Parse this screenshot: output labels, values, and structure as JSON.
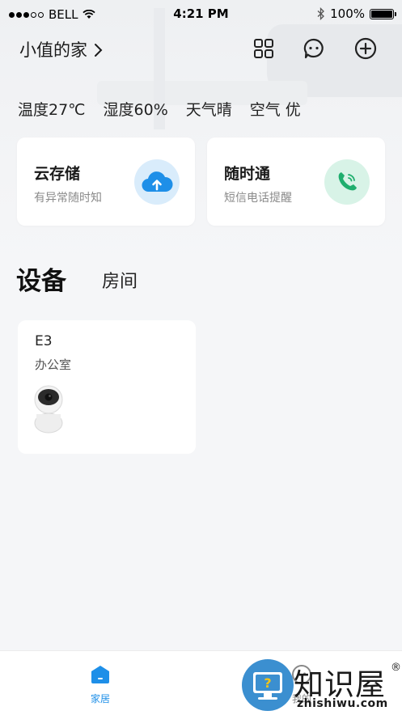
{
  "status_bar": {
    "carrier": "BELL",
    "time": "4:21 PM",
    "battery": "100%"
  },
  "header": {
    "home_name": "小值的家",
    "icons": [
      "grid-icon",
      "message-icon",
      "add-icon"
    ]
  },
  "weather": {
    "temperature": "温度27℃",
    "humidity": "湿度60%",
    "condition": "天气晴",
    "air": "空气 优"
  },
  "services": [
    {
      "title": "云存储",
      "subtitle": "有异常随时知",
      "icon": "cloud-upload-icon",
      "color": "#1e8fe8",
      "bg": "#d9ecfb"
    },
    {
      "title": "随时通",
      "subtitle": "短信电话提醒",
      "icon": "phone-icon",
      "color": "#1fae6e",
      "bg": "#d8f3e7"
    }
  ],
  "tabs": {
    "devices": "设备",
    "rooms": "房间"
  },
  "devices": [
    {
      "name": "E3",
      "room": "办公室",
      "icon": "camera-icon"
    }
  ],
  "tabbar": {
    "home": "家居",
    "mine": "我的",
    "active_color": "#1e8fe8"
  },
  "watermark": {
    "brand": "知识屋",
    "reg": "®",
    "url": "zhishiwu.com"
  }
}
